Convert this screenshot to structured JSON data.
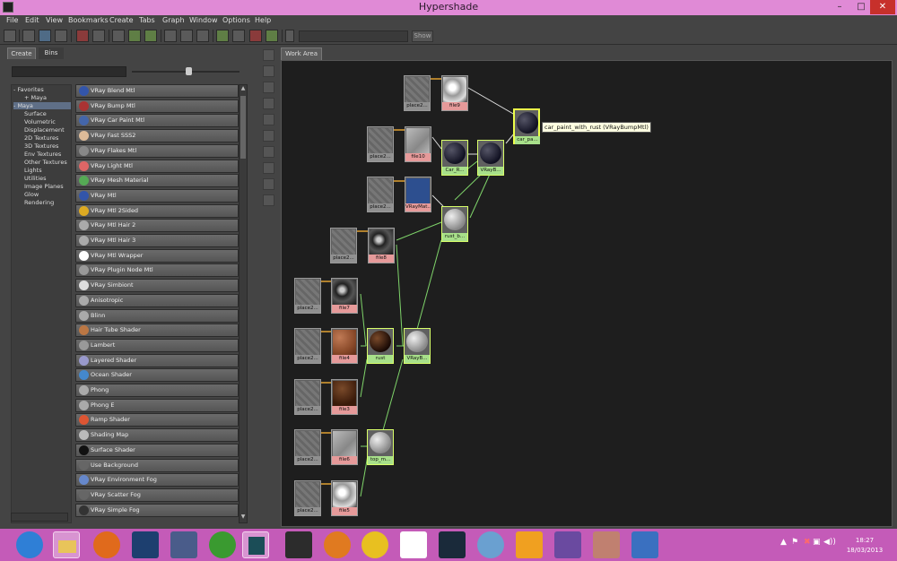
{
  "window": {
    "title": "Hypershade",
    "min_glyph": "–",
    "max_glyph": "□",
    "close_glyph": "✕"
  },
  "menu": [
    "File",
    "Edit",
    "View",
    "Bookmarks",
    "Create",
    "Tabs",
    "Graph",
    "Window",
    "Options",
    "Help"
  ],
  "toolbar": {
    "show_label": "Show",
    "search_value": ""
  },
  "left_panel": {
    "tabs": [
      "Create",
      "Bins"
    ],
    "tree": [
      {
        "label": "Favorites",
        "level": 0,
        "prefix": "-",
        "selected": false
      },
      {
        "label": "Maya",
        "level": 1,
        "prefix": "+",
        "selected": false
      },
      {
        "label": "Maya",
        "level": 0,
        "prefix": "-",
        "selected": true
      },
      {
        "label": "Surface",
        "level": 1,
        "prefix": "",
        "selected": false
      },
      {
        "label": "Volumetric",
        "level": 1,
        "prefix": "",
        "selected": false
      },
      {
        "label": "Displacement",
        "level": 1,
        "prefix": "",
        "selected": false
      },
      {
        "label": "2D Textures",
        "level": 1,
        "prefix": "",
        "selected": false
      },
      {
        "label": "3D Textures",
        "level": 1,
        "prefix": "",
        "selected": false
      },
      {
        "label": "Env Textures",
        "level": 1,
        "prefix": "",
        "selected": false
      },
      {
        "label": "Other Textures",
        "level": 1,
        "prefix": "",
        "selected": false
      },
      {
        "label": "Lights",
        "level": 1,
        "prefix": "",
        "selected": false
      },
      {
        "label": "Utilities",
        "level": 1,
        "prefix": "",
        "selected": false
      },
      {
        "label": "Image Planes",
        "level": 1,
        "prefix": "",
        "selected": false
      },
      {
        "label": "Glow",
        "level": 1,
        "prefix": "",
        "selected": false
      },
      {
        "label": "Rendering",
        "level": 1,
        "prefix": "",
        "selected": false
      }
    ],
    "node_types": [
      {
        "label": "VRay Blend Mtl",
        "icon": "#3355aa"
      },
      {
        "label": "VRay Bump Mtl",
        "icon": "#aa3333"
      },
      {
        "label": "VRay Car Paint Mtl",
        "icon": "#4466aa"
      },
      {
        "label": "VRay Fast SSS2",
        "icon": "#ddbb99"
      },
      {
        "label": "VRay Flakes Mtl",
        "icon": "#888888"
      },
      {
        "label": "VRay Light Mtl",
        "icon": "#dd6666"
      },
      {
        "label": "VRay Mesh Material",
        "icon": "#55aa55"
      },
      {
        "label": "VRay Mtl",
        "icon": "#3355aa"
      },
      {
        "label": "VRay Mtl 2Sided",
        "icon": "#ddaa22"
      },
      {
        "label": "VRay Mtl Hair 2",
        "icon": "#aaaaaa"
      },
      {
        "label": "VRay Mtl Hair 3",
        "icon": "#aaaaaa"
      },
      {
        "label": "VRay Mtl Wrapper",
        "icon": "#ffffff"
      },
      {
        "label": "VRay Plugin Node Mtl",
        "icon": "#999999"
      },
      {
        "label": "VRay Simbiont",
        "icon": "#dddddd"
      },
      {
        "label": "Anisotropic",
        "icon": "#aaaaaa"
      },
      {
        "label": "Blinn",
        "icon": "#aaaaaa"
      },
      {
        "label": "Hair Tube Shader",
        "icon": "#bb7744"
      },
      {
        "label": "Lambert",
        "icon": "#999999"
      },
      {
        "label": "Layered Shader",
        "icon": "#9999cc"
      },
      {
        "label": "Ocean Shader",
        "icon": "#4488cc"
      },
      {
        "label": "Phong",
        "icon": "#aaaaaa"
      },
      {
        "label": "Phong E",
        "icon": "#aaaaaa"
      },
      {
        "label": "Ramp Shader",
        "icon": "#dd5533"
      },
      {
        "label": "Shading Map",
        "icon": "#bbbbbb"
      },
      {
        "label": "Surface Shader",
        "icon": "#111111"
      },
      {
        "label": "Use Background",
        "icon": "#666666"
      },
      {
        "label": "VRay Environment Fog",
        "icon": "#6688cc"
      },
      {
        "label": "VRay Scatter Fog",
        "icon": "#666666"
      },
      {
        "label": "VRay Simple Fog",
        "icon": "#333333"
      }
    ]
  },
  "work_area": {
    "tab": "Work Area",
    "tooltip": "car_paint_with_rust (VRayBumpMtl)",
    "nodes": {
      "place_a": "place2...",
      "file9": "file9",
      "place_b": "place2...",
      "file10": "file10",
      "car_r": "Car_R...",
      "vrayb_top": "VRayB...",
      "car_pa": "car_pa...",
      "place_c": "place2...",
      "vray_mat": "VRayMat...",
      "place_d": "place2...",
      "file8": "file8",
      "rust_b": "rust_b...",
      "place_e": "place2...",
      "file7": "file7",
      "place_f": "place2...",
      "file4": "file4",
      "rust": "rust",
      "vrayb_mid": "VRayB...",
      "place_g": "place2...",
      "file3": "file3",
      "place_h": "place2...",
      "file6": "file6",
      "top_m": "top_m...",
      "place_i": "place2...",
      "file5": "file5"
    }
  },
  "taskbar": {
    "tray": [
      "▲",
      "⚑",
      "✖",
      "▣",
      "◀))"
    ],
    "time": "18:27",
    "date": "18/03/2013"
  }
}
